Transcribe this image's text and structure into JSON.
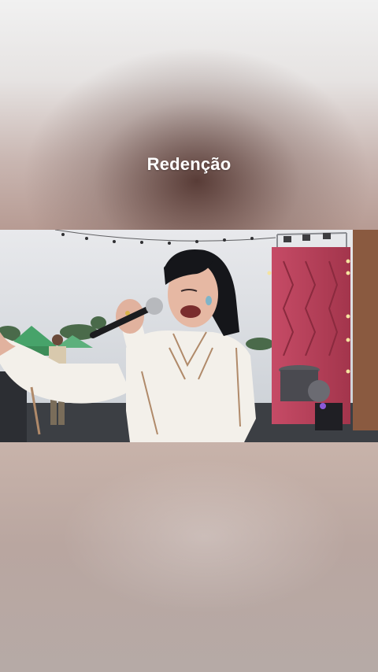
{
  "story": {
    "caption": "Redenção",
    "media_type": "video",
    "scene": {
      "background_colors": [
        "#f1f1f1",
        "#b79b93",
        "#b9a6a0"
      ],
      "stage_color": "#c14a62",
      "tent_color": "#47a36a",
      "blouse_color": "#f3f0ea"
    }
  }
}
